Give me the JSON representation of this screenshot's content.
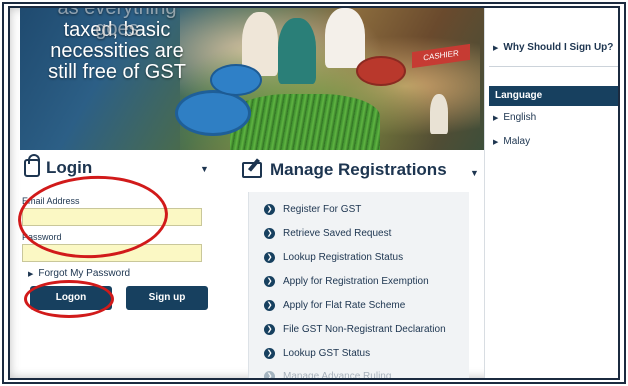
{
  "banner": {
    "line0": "as everything goes",
    "line1": "taxed, basic",
    "line2": "necessities are",
    "line3": "still free of GST",
    "sign": "CASHIER"
  },
  "right_panel": {
    "why_link": "Why Should I Sign Up?",
    "language_heading": "Language",
    "languages": [
      "English",
      "Malay"
    ]
  },
  "login": {
    "title": "Login",
    "email_label": "Email Address",
    "email_value": "",
    "password_label": "Password",
    "password_value": "",
    "forgot_link": "Forgot My Password",
    "logon_button": "Logon",
    "signup_button": "Sign up"
  },
  "registrations": {
    "title": "Manage Registrations",
    "items": [
      "Register For GST",
      "Retrieve Saved Request",
      "Lookup Registration Status",
      "Apply for Registration Exemption",
      "Apply for Flat Rate Scheme",
      "File GST Non-Registrant Declaration",
      "Lookup GST Status",
      "Manage Advance Ruling"
    ]
  },
  "colors": {
    "navy": "#17405f",
    "text": "#1d3550",
    "input_bg": "#fbf8c4",
    "annotation_red": "#d11a1a"
  }
}
